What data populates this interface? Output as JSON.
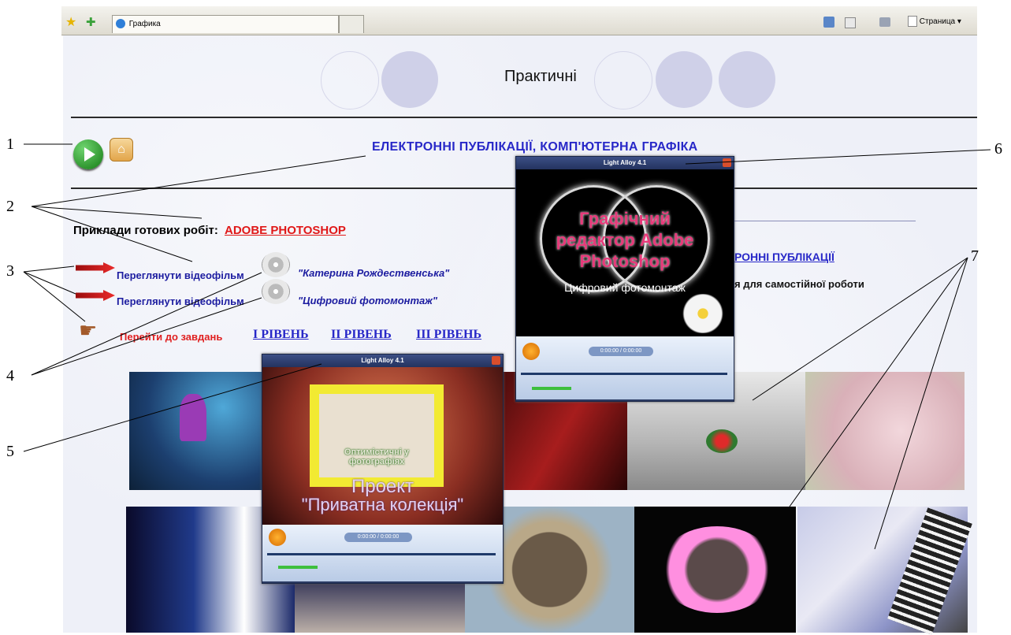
{
  "browser": {
    "tab_title": "Графика",
    "page_menu_label": "Страница"
  },
  "page": {
    "header_text": "Практичні",
    "main_heading": "ЕЛЕКТРОННІ ПУБЛІКАЦІЇ,  КОМП'ЮТЕРНА ГРАФІКА",
    "examples_label": "Приклади готових робіт:",
    "examples_link": "ADOBE PHOTOSHOP",
    "video1_link": "Переглянути відеофільм",
    "video1_title": "\"Катерина Рождественська\"",
    "video2_link": "Переглянути відеофільм",
    "video2_title": "\"Цифровий фотомонтаж\"",
    "tasks_link": "Перейти до завдань",
    "levels": [
      "І РІВЕНЬ",
      "ІІ РІВЕНЬ",
      "ІІІ РІВЕНЬ"
    ],
    "hidden_link": "РОННІ ПУБЛІКАЦІЇ",
    "hidden_text": "я для самостійної роботи"
  },
  "player1": {
    "title": "Light Alloy 4.1",
    "overlay_line1": "Графічний",
    "overlay_line2": "редактор Adobe",
    "overlay_line3": "Photoshop",
    "overlay_sub": "Цифровий фотомонтаж",
    "time": "0:00:00 / 0:00:00"
  },
  "player2": {
    "title": "Light Alloy 4.1",
    "overlay_sign": "Оптимістичні у фотографіях",
    "overlay_line1": "Проект",
    "overlay_line2": "\"Приватна колекція\"",
    "time": "0:00:00 / 0:00:00"
  },
  "callouts": [
    "1",
    "2",
    "3",
    "4",
    "5",
    "6",
    "7"
  ],
  "colors": {
    "page_bg": "#eef0f8",
    "link_blue": "#2828c8",
    "photoshop_red": "#e01818",
    "tasks_red": "#e02020",
    "player_frame": "#2b3b63"
  },
  "icons": [
    "play-icon",
    "home-icon",
    "arrow-icon",
    "disc-icon",
    "pointing-hand-icon",
    "star-icon",
    "home-toolbar-icon",
    "print-icon",
    "rss-icon"
  ]
}
